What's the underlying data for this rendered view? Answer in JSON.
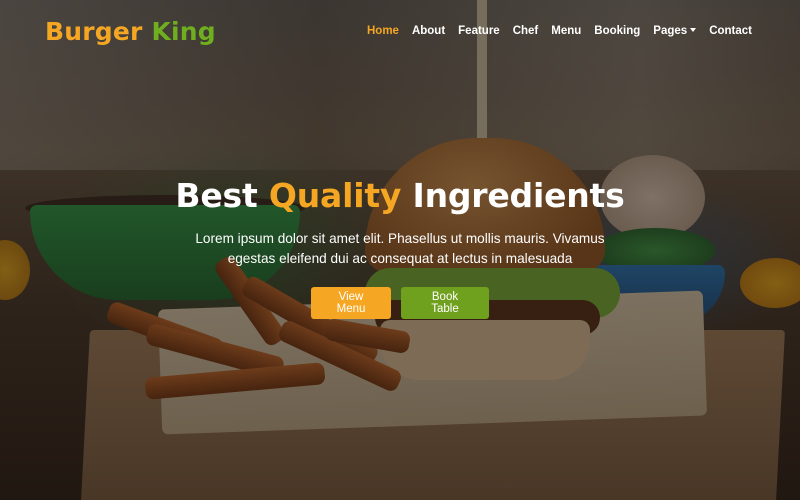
{
  "brand": {
    "part1": "Burger",
    "part2": "King"
  },
  "nav": {
    "items": [
      {
        "label": "Home",
        "active": true
      },
      {
        "label": "About"
      },
      {
        "label": "Feature"
      },
      {
        "label": "Chef"
      },
      {
        "label": "Menu"
      },
      {
        "label": "Booking"
      },
      {
        "label": "Pages",
        "dropdown": true
      },
      {
        "label": "Contact"
      }
    ]
  },
  "hero": {
    "headline_pre": "Best",
    "headline_highlight": "Quality",
    "headline_post": "Ingredients",
    "subtitle": "Lorem ipsum dolor sit amet elit. Phasellus ut mollis mauris. Vivamus egestas eleifend dui ac consequat at lectus in malesuada",
    "primary_button": "View Menu",
    "secondary_button": "Book Table"
  },
  "colors": {
    "accent": "#f5a623",
    "brand_green": "#6fae1e",
    "button_green": "#6fa01e"
  }
}
